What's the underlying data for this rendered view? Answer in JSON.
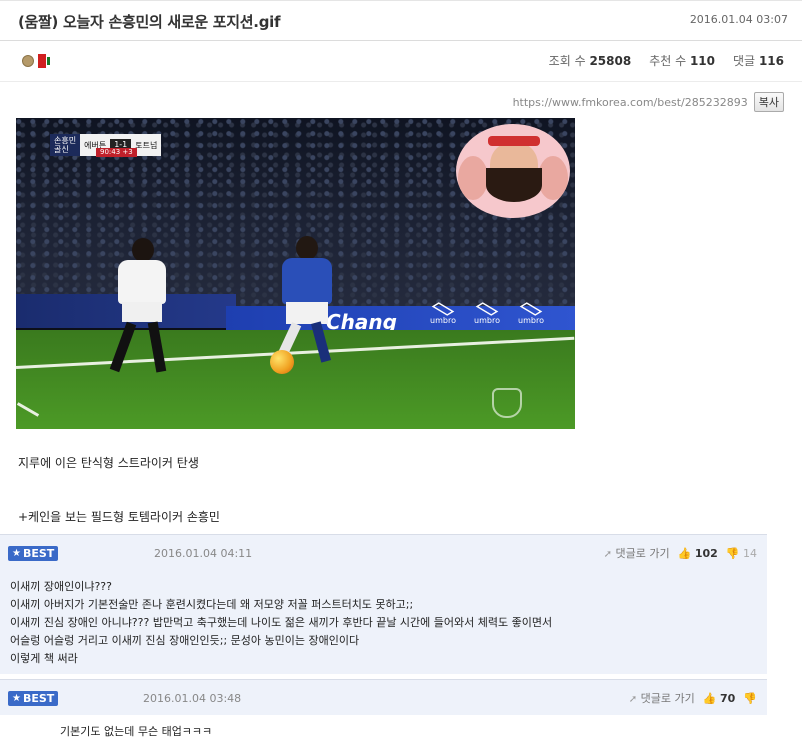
{
  "header": {
    "title": "(움짤) 오늘자 손흥민의 새로운 포지션.gif",
    "date": "2016.01.04 03:07"
  },
  "meta": {
    "views_label": "조회 수",
    "views": "25808",
    "recommend_label": "추천 수",
    "recommend": "110",
    "comments_label": "댓글",
    "comments": "116"
  },
  "url_row": {
    "url": "https://www.fmkorea.com/best/285232893",
    "copy_label": "복사"
  },
  "media": {
    "scorebug": {
      "team_line1": "손흥민",
      "team_line2": "골신",
      "home": "에버튼",
      "score": "1-1",
      "away": "토트넘",
      "time": "90:43",
      "added": "+3"
    },
    "board_text": "Chang",
    "board_logo": "umbro"
  },
  "post": {
    "line1": "지루에 이은 탄식형 스트라이커 탄생",
    "line2": "+케인을 보는 필드형 토템라이커 손흥민"
  },
  "comments": [
    {
      "badge": "BEST",
      "date": "2016.01.04 04:11",
      "reply_label": "댓글로 가기",
      "up": "102",
      "down": "14",
      "lines": [
        "이새끼 장애인이냐???",
        "이새끼 아버지가 기본전술만 존나 훈련시켰다는데 왜 저모양 저꼴 퍼스트터치도 못하고;;",
        "이새끼 진심 장애인 아니냐??? 밥만먹고 축구했는데 나이도 젊은 새끼가 후반다 끝날 시간에 들어와서 체력도 좋이면서",
        "어슬렁 어슬렁 거리고 이새끼 진심 장애인인듯;; 문성아 농민이는 장애인이다",
        "이렇게 책 써라"
      ]
    },
    {
      "badge": "BEST",
      "date": "2016.01.04 03:48",
      "reply_label": "댓글로 가기",
      "up": "70",
      "down": "",
      "lines": [
        "기본기도 없는데 무슨 태업ㅋㅋㅋ"
      ]
    }
  ],
  "colors": {
    "badge": "#3a6ac8",
    "comment_bg": "#eef2fa",
    "board": "#2f55d0"
  }
}
